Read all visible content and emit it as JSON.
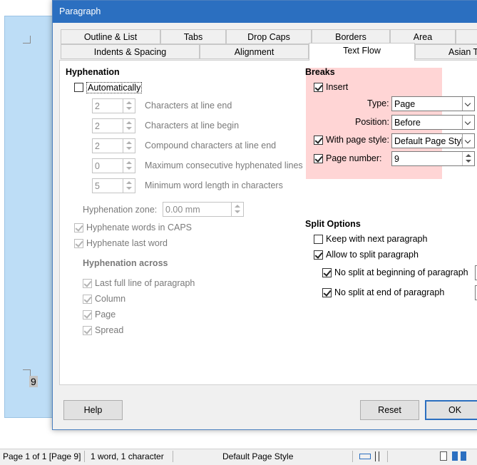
{
  "dialog": {
    "title": "Paragraph",
    "tabs_row1": [
      "Outline & List",
      "Tabs",
      "Drop Caps",
      "Borders",
      "Area",
      ""
    ],
    "tabs_row2": [
      "Indents & Spacing",
      "Alignment",
      "Text Flow",
      "Asian Ty"
    ],
    "active_tab": "Text Flow"
  },
  "hyphenation": {
    "heading": "Hyphenation",
    "automatically": "Automatically",
    "automatically_checked": false,
    "spin_rows": [
      {
        "value": "2",
        "label": "Characters at line end"
      },
      {
        "value": "2",
        "label": "Characters at line begin"
      },
      {
        "value": "2",
        "label": "Compound characters at line end"
      },
      {
        "value": "0",
        "label": "Maximum consecutive hyphenated lines"
      },
      {
        "value": "5",
        "label": "Minimum word length in characters"
      }
    ],
    "zone_label": "Hyphenation zone:",
    "zone_value": "0.00 mm",
    "caps_label": "Hyphenate words in CAPS",
    "last_word_label": "Hyphenate last word",
    "across_heading": "Hyphenation across",
    "across": [
      "Last full line of paragraph",
      "Column",
      "Page",
      "Spread"
    ]
  },
  "breaks": {
    "heading": "Breaks",
    "insert": "Insert",
    "type_label": "Type:",
    "type_value": "Page",
    "position_label": "Position:",
    "position_value": "Before",
    "page_style_label": "With page style:",
    "page_style_value": "Default Page Style",
    "page_number_label": "Page number:",
    "page_number_value": "9"
  },
  "split": {
    "heading": "Split Options",
    "keep_next": "Keep with next paragraph",
    "keep_next_checked": false,
    "allow_split": "Allow to split paragraph",
    "no_split_begin": "No split at beginning of paragraph",
    "no_split_end": "No split at end of paragraph"
  },
  "buttons": {
    "help": "Help",
    "reset": "Reset",
    "ok": "OK"
  },
  "document": {
    "page_number_field": "9"
  },
  "statusbar": {
    "page": "Page 1 of 1 [Page 9]",
    "words": "1 word, 1 character",
    "page_style": "Default Page Style"
  },
  "colors": {
    "title_bar": "#2b6fc0",
    "breaks_highlight": "#ffd5d5",
    "page_sheet": "#bdddf6"
  }
}
